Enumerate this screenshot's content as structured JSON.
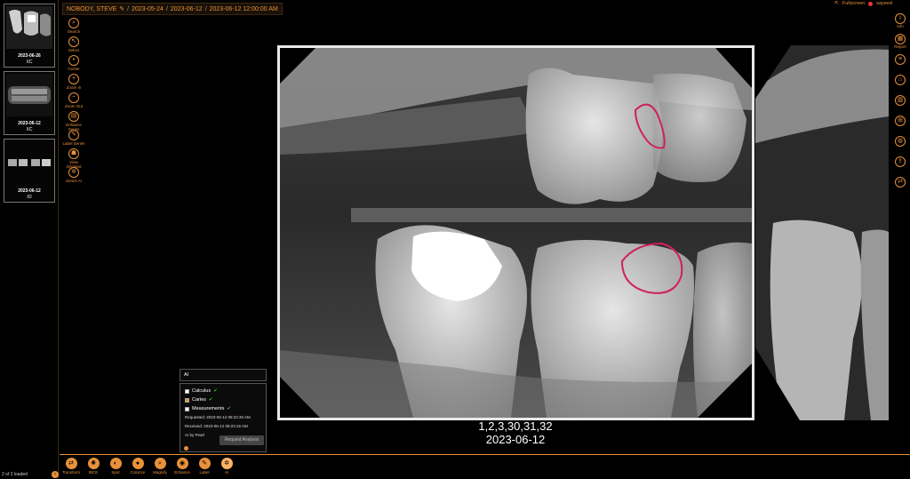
{
  "thumbnails": [
    {
      "date": "2023-06-26",
      "modality": "XC"
    },
    {
      "date": "2023-06-12",
      "modality": "XC"
    },
    {
      "date": "2023-06-12",
      "modality": "IO"
    }
  ],
  "thumb_status": "2 of 2 loaded",
  "breadcrumb": {
    "patient": "NOBODY, STEVE",
    "items": [
      "2023-05-24",
      "2023-06-12",
      "2023-06-12 12:00:00 AM"
    ],
    "separator": "/"
  },
  "top_right": {
    "fullscreen": "Fullscreen",
    "user": "sayeed"
  },
  "left_tools": [
    {
      "label": "Search",
      "icon": "search-icon",
      "glyph": "⌕"
    },
    {
      "label": "Select",
      "icon": "cursor-icon",
      "glyph": "↖"
    },
    {
      "label": "Center",
      "icon": "center-icon",
      "glyph": "•"
    },
    {
      "label": "Zoom In",
      "icon": "plus-icon",
      "glyph": "+"
    },
    {
      "label": "Zoom Out",
      "icon": "minus-icon",
      "glyph": "−"
    },
    {
      "label": "Enhance Series",
      "icon": "enhance-icon",
      "glyph": "▤"
    },
    {
      "label": "Label Series",
      "icon": "label-icon",
      "glyph": "✎"
    },
    {
      "label": "View Ghosted",
      "icon": "ghost-icon",
      "glyph": "☗"
    },
    {
      "label": "Series AI",
      "icon": "ai-icon",
      "glyph": "✲"
    }
  ],
  "right_tools": [
    {
      "label": "Info",
      "icon": "info-icon",
      "glyph": "i"
    },
    {
      "label": "Report",
      "icon": "report-icon",
      "glyph": "▦"
    },
    {
      "label": "",
      "icon": "notes-icon",
      "glyph": "≡"
    },
    {
      "label": "",
      "icon": "tooth-icon",
      "glyph": "⌂"
    },
    {
      "label": "",
      "icon": "chart-icon",
      "glyph": "▥"
    },
    {
      "label": "",
      "icon": "grid-icon",
      "glyph": "⊞"
    },
    {
      "label": "",
      "icon": "globe-icon",
      "glyph": "◍"
    },
    {
      "label": "",
      "icon": "export-icon",
      "glyph": "⇪"
    },
    {
      "label": "",
      "icon": "share-icon",
      "glyph": "⇄"
    }
  ],
  "image_caption": {
    "teeth": "1,2,3,30,31,32",
    "date": "2023-06-12"
  },
  "ai_panel": {
    "title": "AI",
    "findings": [
      {
        "label": "Calculus",
        "checked": false
      },
      {
        "label": "Caries",
        "checked": true
      },
      {
        "label": "Measurements",
        "checked": false
      }
    ],
    "check_mark": "✔",
    "requested": "Requested: 2023-06-12 08:22:46 AM",
    "received": "Received: 2023-06-12 08:23:16 AM",
    "by": "AI by Pearl",
    "request_button": "Request Analysis"
  },
  "bottom_tools": [
    {
      "label": "Transform",
      "icon": "transform-icon",
      "glyph": "⇄"
    },
    {
      "label": "IBCE",
      "icon": "ibce-icon",
      "glyph": "✺"
    },
    {
      "label": "Spot",
      "icon": "spot-icon",
      "glyph": "◐"
    },
    {
      "label": "Colorize",
      "icon": "colorize-icon",
      "glyph": "●"
    },
    {
      "label": "Magnify",
      "icon": "magnify-icon",
      "glyph": "⌕"
    },
    {
      "label": "Enhance",
      "icon": "eye-icon",
      "glyph": "◉"
    },
    {
      "label": "Label",
      "icon": "label-icon",
      "glyph": "✎"
    },
    {
      "label": "AI",
      "icon": "ai-icon",
      "glyph": "✲",
      "active": true
    }
  ],
  "colors": {
    "accent": "#e8913a",
    "annotation": "#d0205a"
  }
}
